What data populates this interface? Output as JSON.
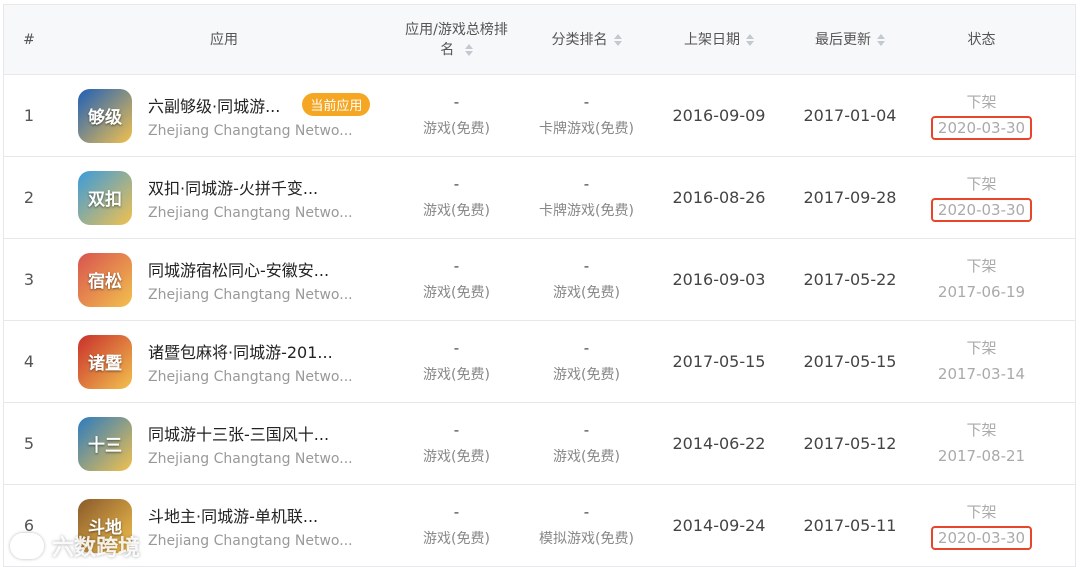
{
  "header": {
    "num": "#",
    "app": "应用",
    "rank": "应用/游戏总榜排名",
    "category_rank": "分类排名",
    "release_date": "上架日期",
    "last_update": "最后更新",
    "status": "状态"
  },
  "current_badge": "当前应用",
  "rows": [
    {
      "num": "1",
      "title": "六副够级·同城游...",
      "developer": "Zhejiang Changtang Netwo...",
      "rank": "-",
      "rank_sub": "游戏(免费)",
      "cat": "-",
      "cat_sub": "卡牌游戏(免费)",
      "release": "2016-09-09",
      "update": "2017-01-04",
      "status": "下架",
      "status_date": "2020-03-30",
      "icon": "app-icon-liufu-gouji",
      "icon_color": "#1e5fb8",
      "icon_glyph": "够级"
    },
    {
      "num": "2",
      "title": "双扣·同城游-火拼千变...",
      "developer": "Zhejiang Changtang Netwo...",
      "rank": "-",
      "rank_sub": "游戏(免费)",
      "cat": "-",
      "cat_sub": "卡牌游戏(免费)",
      "release": "2016-08-26",
      "update": "2017-09-28",
      "status": "下架",
      "status_date": "2020-03-30",
      "icon": "app-icon-shuangkou",
      "icon_color": "#3a9bdc",
      "icon_glyph": "双扣"
    },
    {
      "num": "3",
      "title": "同城游宿松同心-安徽安...",
      "developer": "Zhejiang Changtang Netwo...",
      "rank": "-",
      "rank_sub": "游戏(免费)",
      "cat": "-",
      "cat_sub": "游戏(免费)",
      "release": "2016-09-03",
      "update": "2017-05-22",
      "status": "下架",
      "status_date": "2017-06-19",
      "icon": "app-icon-susong-tongxin",
      "icon_color": "#d9534f",
      "icon_glyph": "宿松"
    },
    {
      "num": "4",
      "title": "诸暨包麻将·同城游-201...",
      "developer": "Zhejiang Changtang Netwo...",
      "rank": "-",
      "rank_sub": "游戏(免费)",
      "cat": "-",
      "cat_sub": "游戏(免费)",
      "release": "2017-05-15",
      "update": "2017-05-15",
      "status": "下架",
      "status_date": "2017-03-14",
      "icon": "app-icon-zhuji-majiang",
      "icon_color": "#c9302c",
      "icon_glyph": "诸暨"
    },
    {
      "num": "5",
      "title": "同城游十三张-三国风十...",
      "developer": "Zhejiang Changtang Netwo...",
      "rank": "-",
      "rank_sub": "游戏(免费)",
      "cat": "-",
      "cat_sub": "游戏(免费)",
      "release": "2014-06-22",
      "update": "2017-05-12",
      "status": "下架",
      "status_date": "2017-08-21",
      "icon": "app-icon-shisanzhang",
      "icon_color": "#2b7bbf",
      "icon_glyph": "十三"
    },
    {
      "num": "6",
      "title": "斗地主·同城游-单机联...",
      "developer": "Zhejiang Changtang Netwo...",
      "rank": "-",
      "rank_sub": "游戏(免费)",
      "cat": "-",
      "cat_sub": "模拟游戏(免费)",
      "release": "2014-09-24",
      "update": "2017-05-11",
      "status": "下架",
      "status_date": "2020-03-30",
      "icon": "app-icon-doudizhu",
      "icon_color": "#8a5a2b",
      "icon_glyph": "斗地"
    }
  ],
  "highlighted_rows": [
    0,
    1,
    5
  ],
  "highlight_color": "#e8462a",
  "badge_color": "#f5a623",
  "watermark": "六数跨境"
}
